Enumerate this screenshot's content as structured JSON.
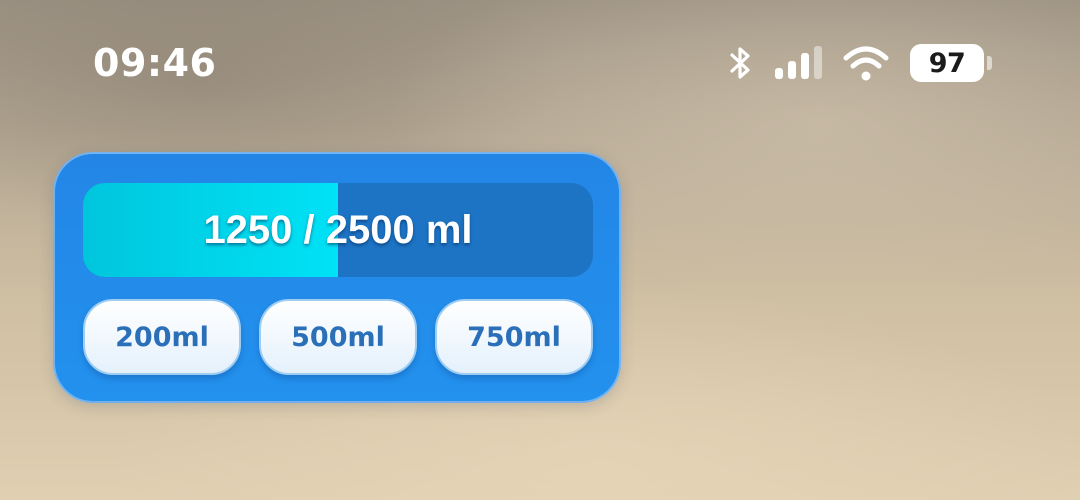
{
  "status_bar": {
    "time": "09:46",
    "battery_level": "97",
    "icons": [
      "bluetooth-icon",
      "cellular-signal-icon",
      "wifi-icon",
      "battery-icon"
    ]
  },
  "widget": {
    "intake_label": "1250 / 2500 ml",
    "progress_fraction": 0.5,
    "buttons": [
      {
        "label": "200ml"
      },
      {
        "label": "500ml"
      },
      {
        "label": "750ml"
      }
    ],
    "colors": {
      "card": "#2389ea",
      "track": "#1d74c4",
      "fill": "#00d6ee",
      "button_text": "#2a6fb8"
    }
  }
}
